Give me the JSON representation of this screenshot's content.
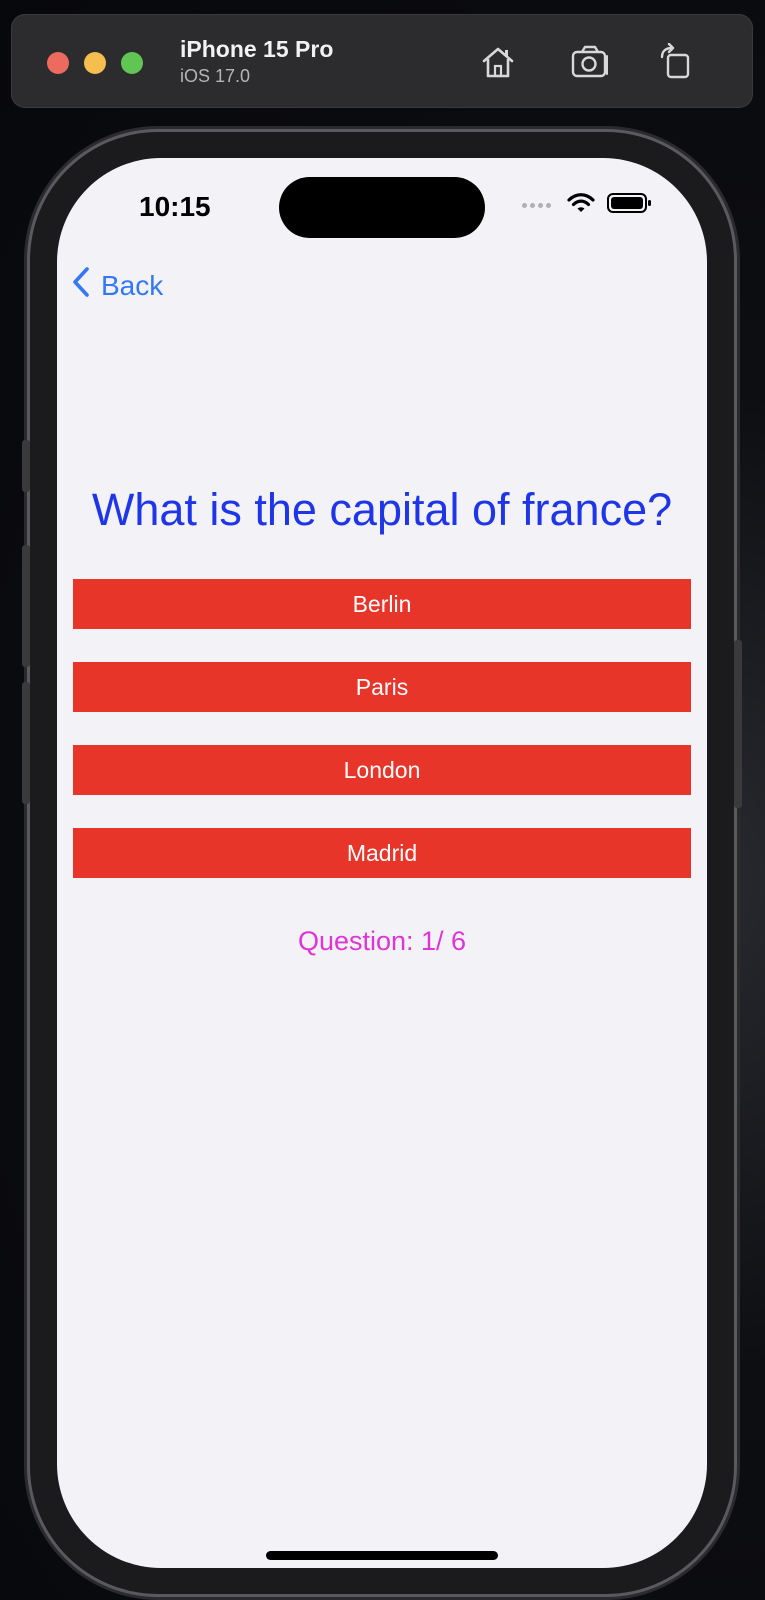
{
  "simulator": {
    "device_name": "iPhone 15 Pro",
    "os_version": "iOS 17.0",
    "icons": [
      "home-icon",
      "screenshot-icon",
      "rotate-icon"
    ]
  },
  "status_bar": {
    "time": "10:15",
    "icons": [
      "wifi-icon",
      "battery-icon"
    ]
  },
  "nav": {
    "back_label": "Back",
    "back_icon": "chevron-left-icon"
  },
  "quiz": {
    "question": "What is the capital of france?",
    "answers": [
      "Berlin",
      "Paris",
      "London",
      "Madrid"
    ],
    "counter": "Question: 1/ 6"
  },
  "colors": {
    "question": "#1f36e8",
    "answer_background": "#e8352a",
    "answer_text": "#ffffff",
    "counter": "#df34d6",
    "back_tint": "#3478f6",
    "screen_background": "#f2f2f7"
  }
}
